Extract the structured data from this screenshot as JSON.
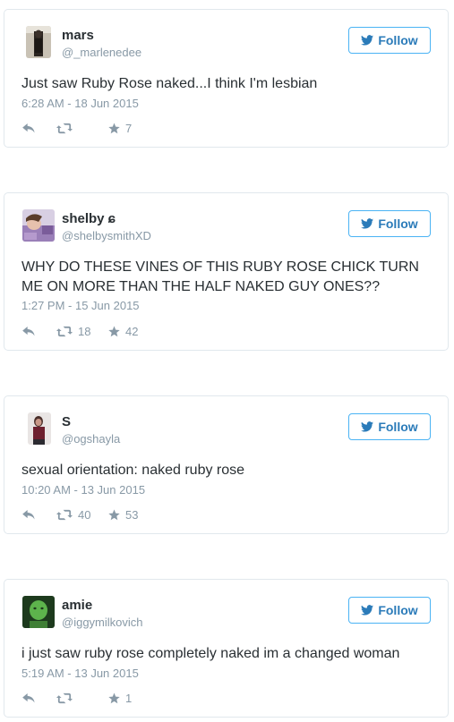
{
  "colors": {
    "follow_blue": "#2b7bb9",
    "follow_border": "#4ab3f4",
    "muted": "#8899a6",
    "card_border": "#e1e8ed"
  },
  "follow_label": "Follow",
  "icons": {
    "follow": "twitter-bird-icon",
    "reply": "reply-icon",
    "retweet": "retweet-icon",
    "favorite": "star-icon"
  },
  "tweets": [
    {
      "name": "mars",
      "handle": "@_marlenedee",
      "text": "Just saw Ruby Rose naked...I think I'm lesbian",
      "timestamp": "6:28 AM - 18 Jun 2015",
      "retweets": "",
      "favorites": "7"
    },
    {
      "name": "shelby ɕ",
      "handle": "@shelbysmithXD",
      "text": "WHY DO THESE VINES OF THIS RUBY ROSE CHICK TURN ME ON MORE THAN THE HALF NAKED GUY ONES??",
      "timestamp": "1:27 PM - 15 Jun 2015",
      "retweets": "18",
      "favorites": "42"
    },
    {
      "name": "S",
      "handle": "@ogshayla",
      "text": "sexual orientation: naked ruby rose",
      "timestamp": "10:20 AM - 13 Jun 2015",
      "retweets": "40",
      "favorites": "53"
    },
    {
      "name": "amie",
      "handle": "@iggymilkovich",
      "text": "i just saw ruby rose completely naked im a changed woman",
      "timestamp": "5:19 AM - 13 Jun 2015",
      "retweets": "",
      "favorites": "1"
    }
  ]
}
